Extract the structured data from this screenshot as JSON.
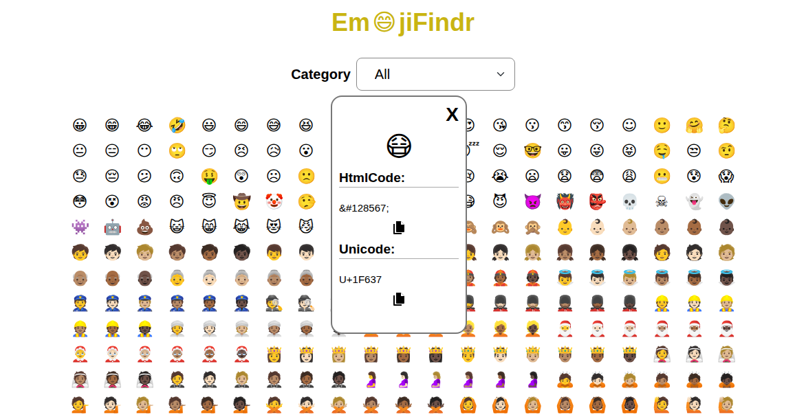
{
  "header": {
    "title_start": "Em",
    "title_emoji": "😄",
    "title_end": "jiFindr"
  },
  "filter": {
    "label": "Category",
    "value": "All"
  },
  "grid": {
    "rows": [
      [
        "😀",
        "😁",
        "😂",
        "🤣",
        "😃",
        "😄",
        "😅",
        "😆",
        "😉",
        "😊",
        "😋",
        "😎",
        "😍",
        "😘",
        "😗",
        "😙",
        "😚",
        "☺",
        "🙂",
        "🤗",
        "🤔"
      ],
      [
        "😐",
        "😑",
        "😶",
        "🙄",
        "😏",
        "😣",
        "😥",
        "😮",
        "🤐",
        "😯",
        "😪",
        "😫",
        "😴",
        "😌",
        "🤓",
        "😛",
        "😜",
        "😝",
        "🤤",
        "😒",
        "🤨"
      ],
      [
        "😓",
        "😔",
        "😕",
        "🙃",
        "🤑",
        "😲",
        "☹",
        "🙁",
        "😖",
        "😞",
        "😟",
        "😤",
        "😢",
        "😭",
        "😦",
        "😧",
        "😨",
        "😩",
        "😬",
        "😰",
        "😱"
      ],
      [
        "😳",
        "😵",
        "😡",
        "😠",
        "😇",
        "🤠",
        "🤡",
        "🤥",
        "🤫",
        "🤭",
        "🧐",
        "🤓",
        "😷",
        "😈",
        "👿",
        "👹",
        "👺",
        "💀",
        "☠",
        "👻",
        "👽"
      ],
      [
        "👾",
        "🤖",
        "💩",
        "😺",
        "😸",
        "😹",
        "😻",
        "😼",
        "😽",
        "🙀",
        "😿",
        "😾",
        "🙈",
        "🙉",
        "🙊",
        "👶",
        "👶🏻",
        "👶🏼",
        "👶🏽",
        "👶🏾",
        "👶🏿"
      ],
      [
        "🧒",
        "🧒🏻",
        "🧒🏼",
        "🧒🏽",
        "🧒🏾",
        "🧒🏿",
        "👦",
        "👦🏻",
        "👦🏼",
        "👦🏽",
        "👦🏾",
        "👦🏿",
        "👧",
        "👧🏻",
        "👧🏼",
        "👧🏽",
        "👧🏾",
        "👧🏿",
        "🧑",
        "🧑🏻",
        "🧑🏼"
      ],
      [
        "👴🏽",
        "👴🏾",
        "👴🏿",
        "👵",
        "👵🏻",
        "👵🏼",
        "👵🏽",
        "👵🏾",
        "👵🏿",
        "👲",
        "👲🏻",
        "👲🏼",
        "👲🏽",
        "👲🏾",
        "👲🏿",
        "👼",
        "👼🏻",
        "👼🏼",
        "👼🏽",
        "👼🏾",
        "👼🏿"
      ],
      [
        "👮",
        "👮🏻",
        "👮🏼",
        "👮🏽",
        "👮🏾",
        "👮🏿",
        "🕵",
        "🕵🏻",
        "🕵🏼",
        "🕵🏽",
        "🕵🏾",
        "🕵🏿",
        "💂",
        "💂🏻",
        "💂🏼",
        "💂🏽",
        "💂🏾",
        "💂🏿",
        "👷",
        "👷🏻",
        "👷🏼"
      ],
      [
        "👷🏽",
        "👷🏾",
        "👷🏿",
        "👳",
        "👳🏻",
        "👳🏼",
        "👳🏽",
        "👳🏾",
        "👳🏿",
        "👱",
        "👱🏻",
        "👱🏼",
        "👱🏽",
        "👱🏾",
        "👱🏿",
        "🎅",
        "🎅🏻",
        "🎅🏼",
        "🎅🏽",
        "🎅🏾",
        "🎅🏿"
      ],
      [
        "🤶",
        "🤶🏻",
        "🤶🏼",
        "🤶🏽",
        "🤶🏾",
        "🤶🏿",
        "👸",
        "👸🏻",
        "👸🏼",
        "👸🏽",
        "👸🏾",
        "👸🏿",
        "🤴",
        "🤴🏻",
        "🤴🏼",
        "🤴🏽",
        "🤴🏾",
        "🤴🏿",
        "👰",
        "👰🏻",
        "👰🏼"
      ],
      [
        "👰🏽",
        "👰🏾",
        "👰🏿",
        "🤵",
        "🤵🏻",
        "🤵🏼",
        "🤵🏽",
        "🤵🏾",
        "🤵🏿",
        "🤰",
        "🤰🏻",
        "🤰🏼",
        "🤰🏽",
        "🤰🏾",
        "🤰🏿",
        "🙇",
        "🙇🏻",
        "🙇🏼",
        "🙇🏽",
        "🙇🏾",
        "🙇🏿"
      ],
      [
        "💁",
        "💁🏻",
        "💁🏼",
        "💁🏽",
        "💁🏾",
        "💁🏿",
        "🙅",
        "🙅🏻",
        "🙅🏼",
        "🙅🏽",
        "🙅🏾",
        "🙅🏿",
        "🙆",
        "🙆🏻",
        "🙆🏼",
        "🙆🏽",
        "🙆🏾",
        "🙆🏿",
        "🙋",
        "🙋🏻",
        "🙋🏼"
      ]
    ]
  },
  "popup": {
    "close": "X",
    "emoji": "😷",
    "fields": [
      {
        "label": "HtmlCode:",
        "value": "&#128567;"
      },
      {
        "label": "Unicode:",
        "value": "U+1F637"
      }
    ]
  }
}
